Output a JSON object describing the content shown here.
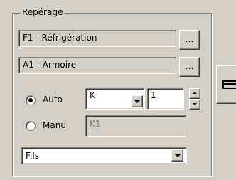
{
  "group": {
    "title": "Repérage"
  },
  "fields": {
    "ref1": {
      "value": "F1 - Réfrigération",
      "browse_label": "..."
    },
    "ref2": {
      "value": "A1 - Armoire",
      "browse_label": "..."
    }
  },
  "mode": {
    "auto_label": "Auto",
    "manu_label": "Manu",
    "selected": "Auto",
    "prefix_value": "K",
    "number_value": "1",
    "manual_value": "K1"
  },
  "bottom_select": {
    "value": "Fils"
  },
  "icons": {
    "dropdown": "chevron-down-icon",
    "spin_up": "spin-up-icon",
    "spin_down": "spin-down-icon",
    "side": "list-lines-icon"
  }
}
